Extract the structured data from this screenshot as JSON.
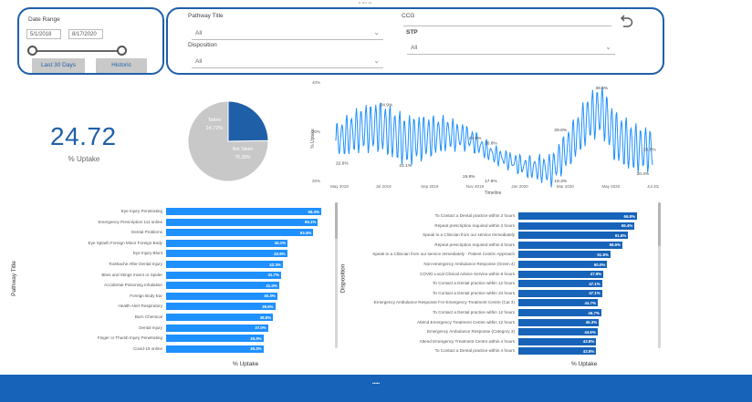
{
  "header": {
    "caption": "•• •••• •••"
  },
  "date_filter": {
    "label": "Date Range",
    "start": "5/1/2018",
    "end": "8/17/2020",
    "buttons": [
      "Last 30 Days",
      "Historic"
    ],
    "slider": {
      "start": 0.05,
      "end": 0.78
    }
  },
  "filters": {
    "pathway_title": {
      "label": "Pathway Title",
      "value": "All"
    },
    "ccg": {
      "label": "CCG",
      "value": ""
    },
    "disposition": {
      "label": "Disposition",
      "value": "All"
    },
    "stp": {
      "label": "STP",
      "value": "All"
    }
  },
  "kpi": {
    "value": "24.72",
    "label": "% Uptake"
  },
  "pie": {
    "slices": [
      {
        "label": "Taken",
        "value": "24.72%",
        "fraction": 0.2472,
        "color": "#1f5fa8"
      },
      {
        "label": "Not Taken",
        "value": "75.28%",
        "fraction": 0.7528,
        "color": "#c8c8c8"
      }
    ]
  },
  "line_chart": {
    "ylabel": "% Uptake",
    "xlabel": "Timeline",
    "y_ticks": [
      "40%",
      "30%",
      "20%"
    ],
    "ylim": [
      20,
      40
    ],
    "x_ticks": [
      "May 2019",
      "Jul 2019",
      "Sep 2019",
      "Nov 2019",
      "Jan 2020",
      "Mar 2020",
      "May 2020",
      "Jul 2020"
    ],
    "annotations": [
      {
        "text": "34.9%",
        "t": 0.14,
        "y": 34.9
      },
      {
        "text": "22.6%",
        "t": 0.0,
        "y": 22.6
      },
      {
        "text": "22.1%",
        "t": 0.2,
        "y": 22.1
      },
      {
        "text": "27.9%",
        "t": 0.42,
        "y": 27.9
      },
      {
        "text": "26.8%",
        "t": 0.47,
        "y": 26.8
      },
      {
        "text": "19.8%",
        "t": 0.4,
        "y": 19.8
      },
      {
        "text": "17.6%",
        "t": 0.47,
        "y": 17.6
      },
      {
        "text": "29.6%",
        "t": 0.69,
        "y": 29.6
      },
      {
        "text": "18.3%",
        "t": 0.69,
        "y": 18.3
      },
      {
        "text": "38.5%",
        "t": 0.82,
        "y": 38.5
      },
      {
        "text": "25.5%",
        "t": 1.0,
        "y": 25.5
      },
      {
        "text": "20.4%",
        "t": 0.95,
        "y": 20.4
      }
    ]
  },
  "chart_data": [
    {
      "type": "bar",
      "ylabel": "Pathway Title",
      "xlabel": "% Uptake",
      "categories": [
        "Eye Injury Penetrating",
        "Emergency Prescription 111 online",
        "Dental Problems",
        "Eye Splash Foreign Minor Foreign Body",
        "Eye Injury Blunt",
        "Toothache After Dental Injury",
        "Bites and Stings Insect or Spider",
        "Accidental Poisoning Inhalation",
        "Foreign Body Ear",
        "Health Alert Respiratory",
        "Burn Chemical",
        "Dental Injury",
        "Finger or Thumb Injury Penetrating",
        "Covid-19 online"
      ],
      "values": [
        56.3,
        55.1,
        53.4,
        44.1,
        43.9,
        42.3,
        41.7,
        41.0,
        40.3,
        39.6,
        38.8,
        37.0,
        35.3,
        35.3
      ],
      "value_labels": [
        "56.3%",
        "55.1%",
        "53.4%",
        "44.1%",
        "43.9%",
        "42.3%",
        "41.7%",
        "41.0%",
        "40.3%",
        "39.6%",
        "38.8%",
        "37.0%",
        "35.3%",
        "35.3%"
      ],
      "color": "#1e90ff"
    },
    {
      "type": "bar",
      "ylabel": "Disposition",
      "xlabel": "% Uptake",
      "categories": [
        "To Contact a Dental practice within 2 hours",
        "Repeat prescription required within 2 hours",
        "Speak to a Clinician from our service Immediately",
        "Repeat prescription required within 6 hours",
        "Speak to a Clinician from our service Immediately - Patient Centric Approach",
        "Non-emergency Ambulance Response (Green 4)",
        "COVID Local Clinical Advice Service within 6 hours",
        "To Contact a Dental practice within 12 hours",
        "To Contact a Dental practice within 24 hours",
        "Emergency Ambulance Response For Emergency Treatment Centre (Cat 3)",
        "To Contact a Dental practice within 12 hours",
        "Attend Emergency Treatment Centre within 12 hours",
        "Emergency Ambulance Response (Category 3)",
        "Attend Emergency Treatment Centre within 4 hours",
        "To Contact a Dental practice within 4 hours"
      ],
      "values": [
        66.8,
        65.4,
        61.8,
        58.6,
        51.8,
        50.0,
        47.9,
        47.1,
        47.1,
        44.7,
        46.7,
        45.3,
        44.6,
        43.8,
        43.8
      ],
      "value_labels": [
        "66.8%",
        "65.4%",
        "61.8%",
        "58.6%",
        "51.8%",
        "50.0%",
        "47.9%",
        "47.1%",
        "47.1%",
        "44.7%",
        "46.7%",
        "45.3%",
        "44.6%",
        "43.8%",
        "43.8%"
      ],
      "color": "#1663b9"
    }
  ],
  "footer": {
    "text": "•••••"
  }
}
